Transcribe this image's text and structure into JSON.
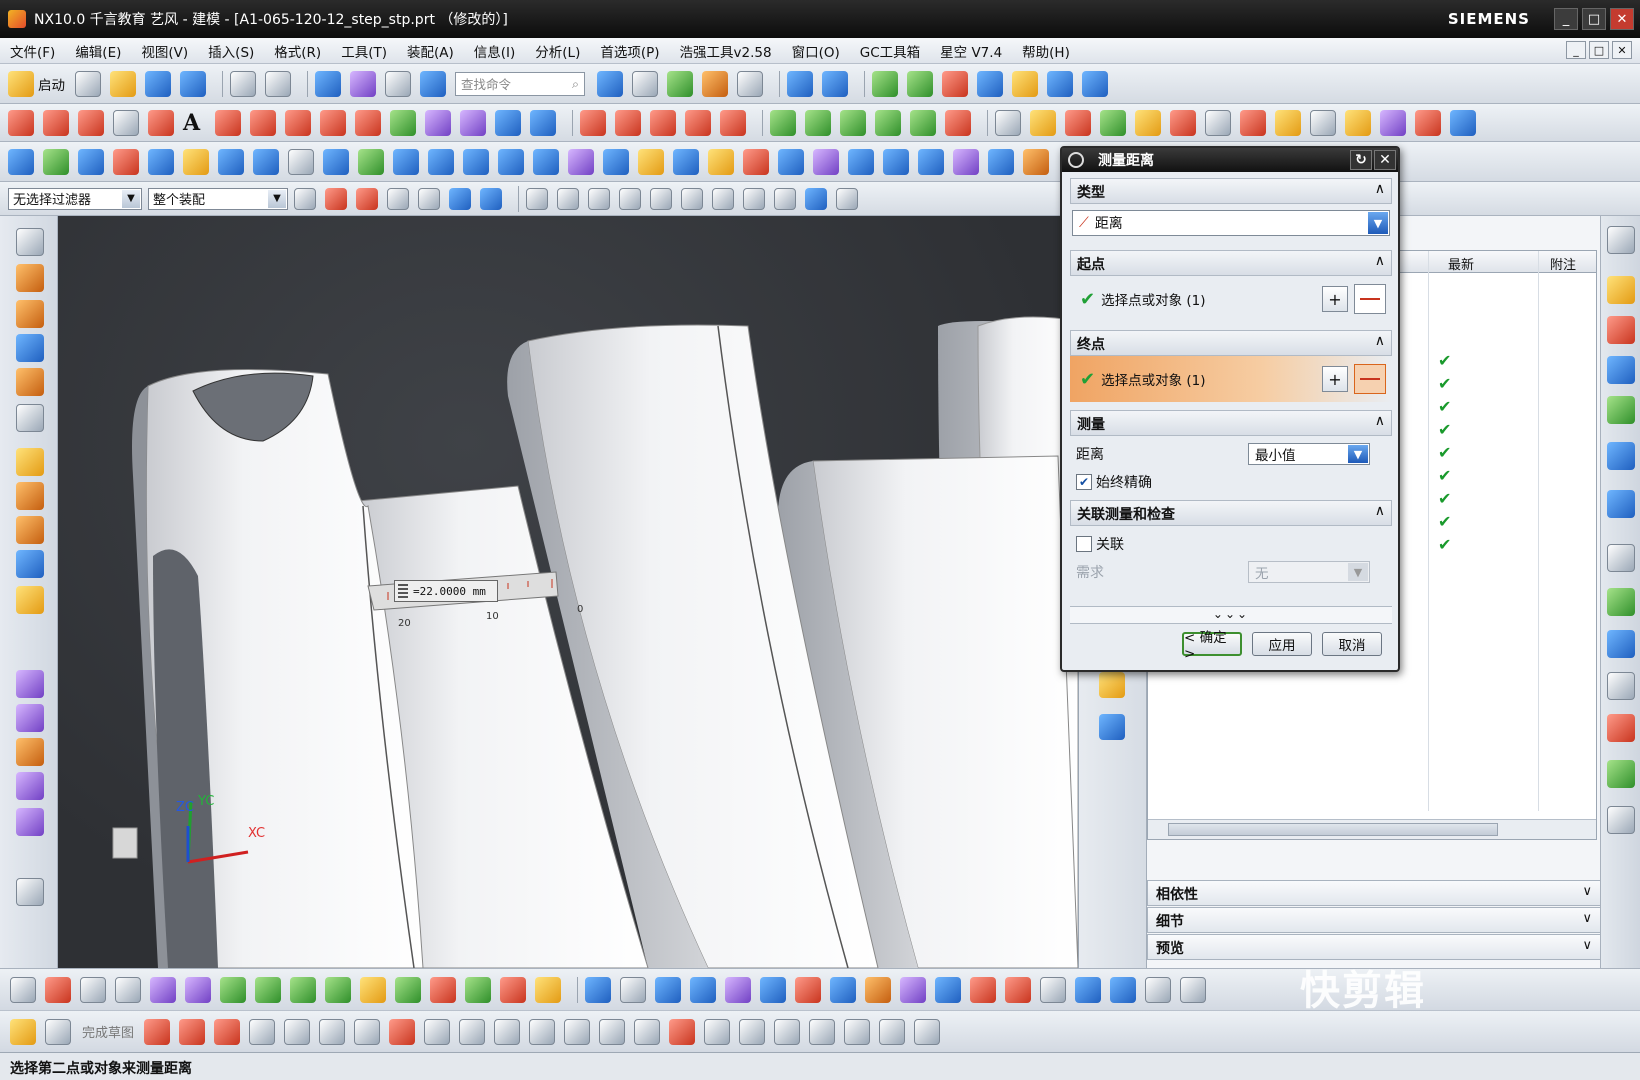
{
  "window": {
    "title": "NX10.0 千言教育 艺风 - 建模 - [A1-065-120-12_step_stp.prt （修改的）]",
    "brand": "SIEMENS",
    "controls": {
      "minimize": "_",
      "maximize": "□",
      "close": "✕"
    }
  },
  "menu": {
    "items": [
      "文件(F)",
      "编辑(E)",
      "视图(V)",
      "插入(S)",
      "格式(R)",
      "工具(T)",
      "装配(A)",
      "信息(I)",
      "分析(L)",
      "首选项(P)",
      "浩强工具v2.58",
      "窗口(O)",
      "GC工具箱",
      "星空 V7.4",
      "帮助(H)"
    ]
  },
  "toolbar": {
    "start_label": "启动",
    "search_placeholder": "查找命令",
    "text_tool": "A"
  },
  "filters": {
    "selection_filter": "无选择过滤器",
    "scope": "整个装配"
  },
  "viewport": {
    "measurement": "=22.0000 mm",
    "ruler_ticks": [
      "20",
      "10",
      "0"
    ],
    "axes": {
      "x": "XC",
      "y": "YC",
      "z": "ZC"
    }
  },
  "navigator": {
    "columns": {
      "latest": "最新",
      "note": "附注"
    },
    "checked_rows": 9,
    "sections": [
      "相依性",
      "细节",
      "预览"
    ]
  },
  "dialog": {
    "title": "测量距离",
    "type_group": {
      "label": "类型",
      "value": "距离"
    },
    "start_group": {
      "label": "起点",
      "select": "选择点或对象 (1)"
    },
    "end_group": {
      "label": "终点",
      "select": "选择点或对象 (1)"
    },
    "measure_group": {
      "label": "测量",
      "distance_label": "距离",
      "distance_value": "最小值",
      "always_accurate": "始终精确"
    },
    "assoc_group": {
      "label": "关联测量和检查",
      "associative": "关联",
      "requirement_label": "需求",
      "requirement_value": "无"
    },
    "more": "⌄⌄⌄",
    "buttons": {
      "ok": "< 确定 >",
      "apply": "应用",
      "cancel": "取消"
    }
  },
  "bottom_toolbar": {
    "finish_sketch": "完成草图"
  },
  "status": {
    "message": "选择第二点或对象来测量距离"
  },
  "watermark": "快剪辑"
}
